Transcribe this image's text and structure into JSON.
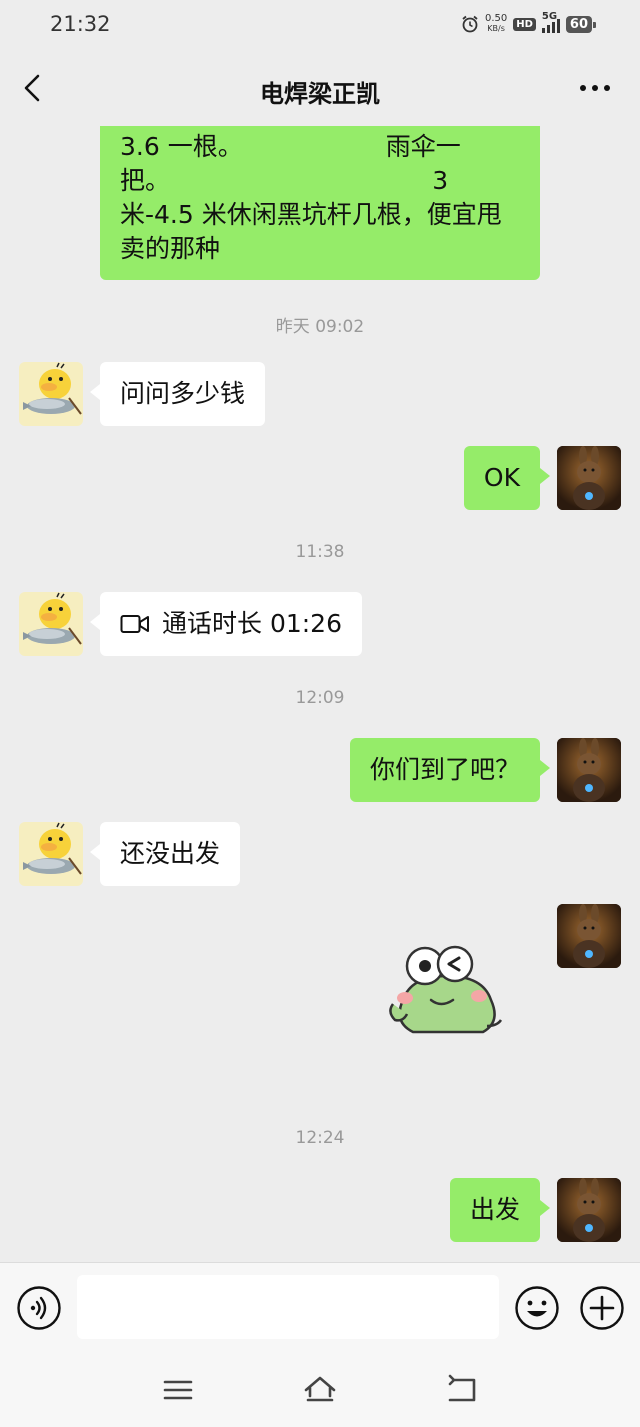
{
  "status_bar": {
    "time": "21:32",
    "net_speed_value": "0.50",
    "net_speed_unit": "KB/s",
    "hd_label": "HD",
    "network_label": "5G",
    "battery_level": "60"
  },
  "nav": {
    "title": "电焊梁正凯"
  },
  "messages": {
    "m1_text": "3.6 一根。                  雨伞一\n把。                                 3\n米-4.5 米休闲黑坑杆几根，便宜甩\n卖的那种",
    "ts1": "昨天 09:02",
    "m2_text": "问问多少钱",
    "m3_text": "OK",
    "ts2": "11:38",
    "m4_text": "通话时长 01:26",
    "ts3": "12:09",
    "m5_text": "你们到了吧？",
    "m6_text": "还没出发",
    "ts4": "12:24",
    "m8_text": "出发"
  },
  "icons": {
    "back": "chevron-left-icon",
    "more": "more-dots-icon",
    "video_call": "video-camera-icon",
    "voice": "voice-input-icon",
    "emoji": "emoji-icon",
    "plus": "plus-icon",
    "sticker": "frog-sticker",
    "menu": "menu-icon",
    "home": "home-icon",
    "back_nav": "back-nav-icon"
  },
  "colors": {
    "own_bubble": "#95ec69",
    "other_bubble": "#ffffff",
    "background": "#ededed"
  }
}
